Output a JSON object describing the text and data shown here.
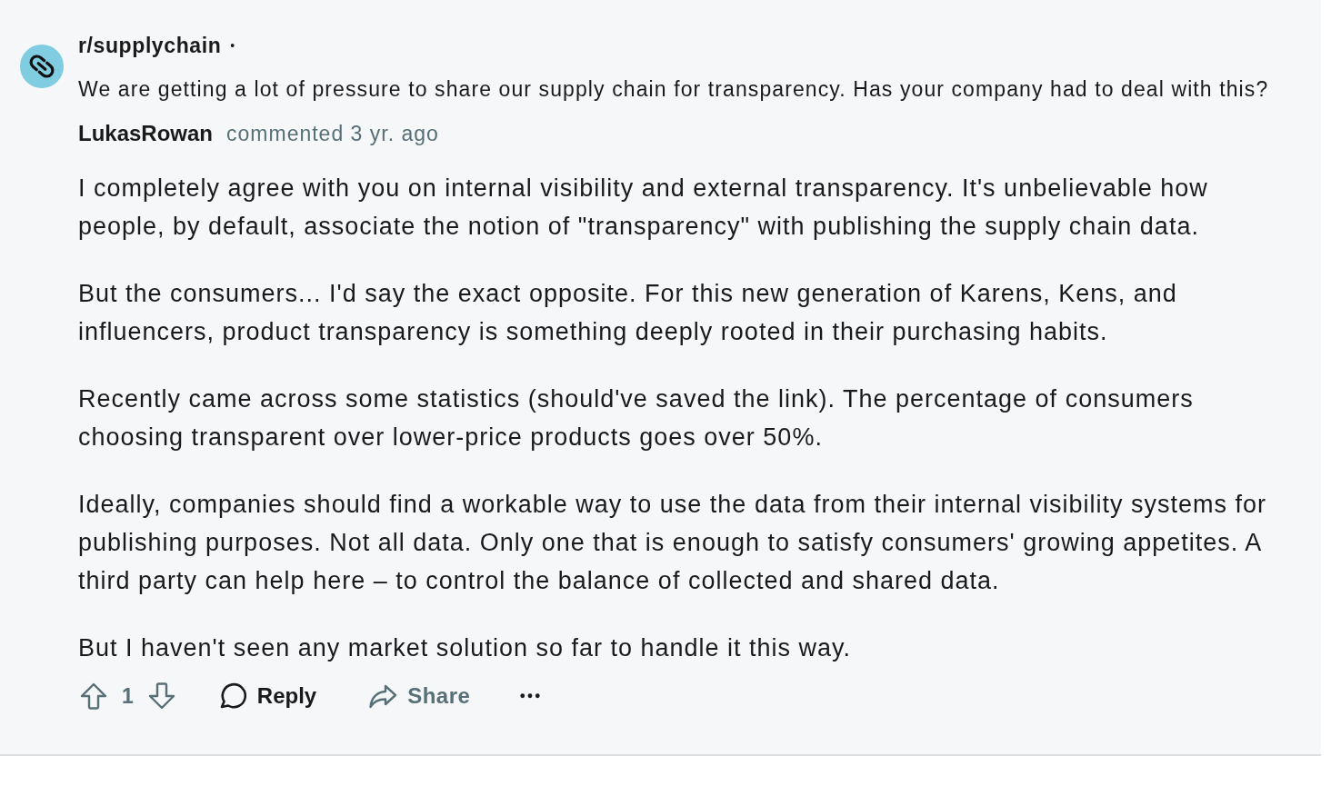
{
  "post": {
    "subreddit": "r/supplychain",
    "separator": "•",
    "title": "We are getting a lot of pressure to share our supply chain for transparency. Has your company had to deal with this?"
  },
  "comment": {
    "author": "LukasRowan",
    "meta": "commented 3 yr. ago",
    "paragraphs": [
      "I completely agree with you on internal visibility and external transparency. It's unbelievable how people, by default, associate the notion of \"transparency\" with publishing the supply chain data.",
      "But the consumers... I'd say the exact opposite. For this new generation of Karens, Kens, and influencers, product transparency is something deeply rooted in their purchasing habits.",
      "Recently came across some statistics (should've saved the link). The percentage of consumers choosing transparent over lower-price products goes over 50%.",
      "Ideally, companies should find a workable way to use the data from their internal visibility systems for publishing purposes. Not all data. Only one that is enough to satisfy consumers' growing appetites. A third party can help here – to control the balance of collected and shared data.",
      "But I haven't seen any market solution so far to handle it this way."
    ]
  },
  "actions": [
    {
      "kind": "vote",
      "score": "1"
    },
    {
      "kind": "reply",
      "label": "Reply"
    },
    {
      "kind": "share",
      "label": "Share"
    },
    {
      "kind": "more"
    }
  ]
}
